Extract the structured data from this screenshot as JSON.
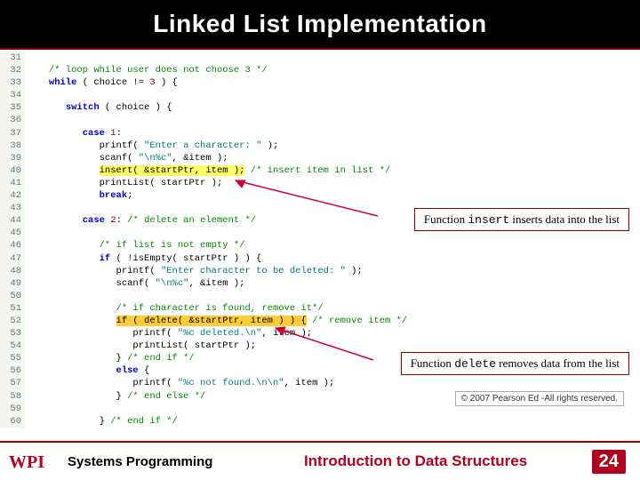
{
  "title": "Linked List Implementation",
  "code": {
    "lines": [
      {
        "n": "31",
        "t": ""
      },
      {
        "n": "32",
        "t": "   ",
        "seg": [
          {
            "c": "cm",
            "t": "/* loop while user does not choose 3 */"
          }
        ]
      },
      {
        "n": "33",
        "t": "   ",
        "seg": [
          {
            "c": "kw",
            "t": "while"
          },
          {
            "t": " ( choice != "
          },
          {
            "c": "num",
            "t": "3"
          },
          {
            "t": " ) {"
          }
        ]
      },
      {
        "n": "34",
        "t": ""
      },
      {
        "n": "35",
        "t": "      ",
        "seg": [
          {
            "c": "kw",
            "t": "switch"
          },
          {
            "t": " ( choice ) {"
          }
        ]
      },
      {
        "n": "36",
        "t": ""
      },
      {
        "n": "37",
        "t": "         ",
        "seg": [
          {
            "c": "kw",
            "t": "case"
          },
          {
            "t": " "
          },
          {
            "c": "num",
            "t": "1"
          },
          {
            "t": ":"
          }
        ]
      },
      {
        "n": "38",
        "t": "            ",
        "seg": [
          {
            "t": "printf( "
          },
          {
            "c": "str",
            "t": "\"Enter a character: \""
          },
          {
            "t": " );"
          }
        ]
      },
      {
        "n": "39",
        "t": "            ",
        "seg": [
          {
            "t": "scanf( "
          },
          {
            "c": "str",
            "t": "\"\\n%c\""
          },
          {
            "t": ", &item );"
          }
        ]
      },
      {
        "n": "40",
        "t": "            ",
        "seg": [
          {
            "c": "hl-yellow",
            "t": "insert( &startPtr, item );"
          },
          {
            "t": " "
          },
          {
            "c": "cm",
            "t": "/* insert item in list */"
          }
        ]
      },
      {
        "n": "41",
        "t": "            ",
        "seg": [
          {
            "t": "printList( startPtr );"
          }
        ]
      },
      {
        "n": "42",
        "t": "            ",
        "seg": [
          {
            "c": "kw",
            "t": "break"
          },
          {
            "t": ";"
          }
        ]
      },
      {
        "n": "43",
        "t": ""
      },
      {
        "n": "44",
        "t": "         ",
        "seg": [
          {
            "c": "kw",
            "t": "case"
          },
          {
            "t": " "
          },
          {
            "c": "num",
            "t": "2"
          },
          {
            "t": ": "
          },
          {
            "c": "cm",
            "t": "/* delete an element */"
          }
        ]
      },
      {
        "n": "45",
        "t": ""
      },
      {
        "n": "46",
        "t": "            ",
        "seg": [
          {
            "c": "cm",
            "t": "/* if list is not empty */"
          }
        ]
      },
      {
        "n": "47",
        "t": "            ",
        "seg": [
          {
            "c": "kw",
            "t": "if"
          },
          {
            "t": " ( !isEmpty( startPtr ) ) {"
          }
        ]
      },
      {
        "n": "48",
        "t": "               ",
        "seg": [
          {
            "t": "printf( "
          },
          {
            "c": "str",
            "t": "\"Enter character to be deleted: \""
          },
          {
            "t": " );"
          }
        ]
      },
      {
        "n": "49",
        "t": "               ",
        "seg": [
          {
            "t": "scanf( "
          },
          {
            "c": "str",
            "t": "\"\\n%c\""
          },
          {
            "t": ", &item );"
          }
        ]
      },
      {
        "n": "50",
        "t": ""
      },
      {
        "n": "51",
        "t": "               ",
        "seg": [
          {
            "c": "cm",
            "t": "/* if character is found, remove it*/"
          }
        ]
      },
      {
        "n": "52",
        "t": "               ",
        "seg": [
          {
            "c": "hl-orange",
            "t": "if ( delete( &startPtr, item ) ) {"
          },
          {
            "t": " "
          },
          {
            "c": "cm",
            "t": "/* remove item */"
          }
        ]
      },
      {
        "n": "53",
        "t": "                  ",
        "seg": [
          {
            "t": "printf( "
          },
          {
            "c": "str",
            "t": "\"%c deleted.\\n\""
          },
          {
            "t": ", item );"
          }
        ]
      },
      {
        "n": "54",
        "t": "                  ",
        "seg": [
          {
            "t": "printList( startPtr );"
          }
        ]
      },
      {
        "n": "55",
        "t": "               ",
        "seg": [
          {
            "t": "} "
          },
          {
            "c": "cm",
            "t": "/* end if */"
          }
        ]
      },
      {
        "n": "56",
        "t": "               ",
        "seg": [
          {
            "c": "kw",
            "t": "else"
          },
          {
            "t": " {"
          }
        ]
      },
      {
        "n": "57",
        "t": "                  ",
        "seg": [
          {
            "t": "printf( "
          },
          {
            "c": "str",
            "t": "\"%c not found.\\n\\n\""
          },
          {
            "t": ", item );"
          }
        ]
      },
      {
        "n": "58",
        "t": "               ",
        "seg": [
          {
            "t": "} "
          },
          {
            "c": "cm",
            "t": "/* end else */"
          }
        ]
      },
      {
        "n": "59",
        "t": ""
      },
      {
        "n": "60",
        "t": "            ",
        "seg": [
          {
            "t": "} "
          },
          {
            "c": "cm",
            "t": "/* end if */"
          }
        ]
      }
    ]
  },
  "callouts": {
    "insert": {
      "pre": "Function ",
      "code": "insert",
      "post": " inserts data into the list"
    },
    "delete": {
      "pre": "Function ",
      "code": "delete",
      "post": " removes data from the list"
    }
  },
  "copyright": "© 2007 Pearson Ed -All rights reserved.",
  "footer": {
    "left": "Systems Programming",
    "center": "Introduction to Data Structures",
    "page": "24"
  }
}
